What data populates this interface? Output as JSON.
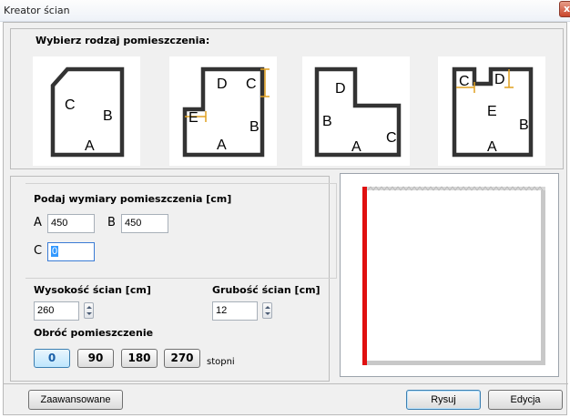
{
  "window": {
    "title": "Kreator ścian",
    "close_glyph": "x"
  },
  "room_type": {
    "heading": "Wybierz rodzaj pomieszczenia:",
    "shapes": [
      {
        "labels": [
          "A",
          "B",
          "C"
        ]
      },
      {
        "labels": [
          "A",
          "B",
          "C",
          "D",
          "E"
        ]
      },
      {
        "labels": [
          "A",
          "B",
          "C",
          "D"
        ]
      },
      {
        "labels": [
          "A",
          "B",
          "C",
          "D",
          "E"
        ]
      }
    ]
  },
  "dimensions": {
    "heading": "Podaj wymiary pomieszczenia [cm]",
    "a_label": "A",
    "a_value": "450",
    "b_label": "B",
    "b_value": "450",
    "c_label": "C",
    "c_value": "0"
  },
  "walls": {
    "height_label": "Wysokość ścian [cm]",
    "height_value": "260",
    "thickness_label": "Grubość ścian [cm]",
    "thickness_value": "12"
  },
  "rotation": {
    "heading": "Obróć pomieszczenie",
    "options": [
      "0",
      "90",
      "180",
      "270"
    ],
    "selected": "0",
    "unit": "stopni"
  },
  "buttons": {
    "advanced": "Zaawansowane",
    "draw": "Rysuj",
    "edit": "Edycja"
  },
  "colors": {
    "wall_highlight": "#e01010",
    "wall": "#c8c8c8",
    "accent": "#3c7fb1"
  }
}
